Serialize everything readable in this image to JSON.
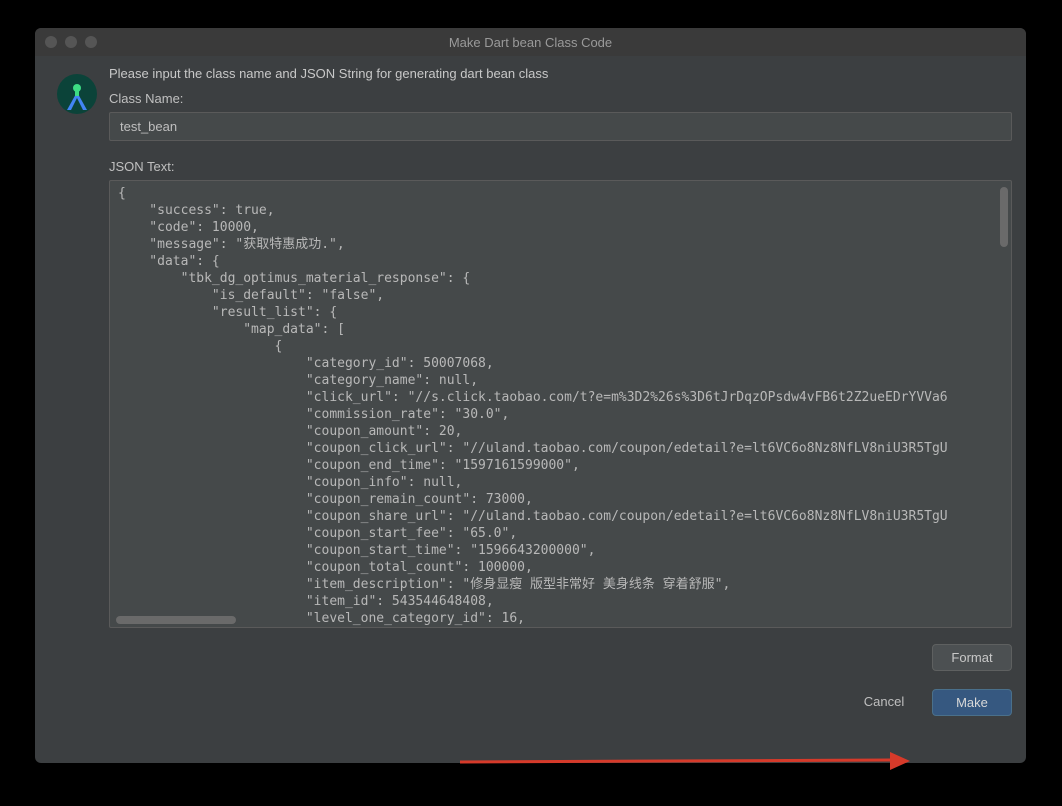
{
  "window": {
    "title": "Make Dart bean Class Code"
  },
  "instruction": "Please input the class name and JSON String for generating dart bean class",
  "classNameLabel": "Class Name:",
  "classNameValue": "test_bean",
  "jsonTextLabel": "JSON Text:",
  "jsonTextValue": "{\n    \"success\": true,\n    \"code\": 10000,\n    \"message\": \"获取特惠成功.\",\n    \"data\": {\n        \"tbk_dg_optimus_material_response\": {\n            \"is_default\": \"false\",\n            \"result_list\": {\n                \"map_data\": [\n                    {\n                        \"category_id\": 50007068,\n                        \"category_name\": null,\n                        \"click_url\": \"//s.click.taobao.com/t?e=m%3D2%26s%3D6tJrDqzOPsdw4vFB6t2Z2ueEDrYVVa6\n                        \"commission_rate\": \"30.0\",\n                        \"coupon_amount\": 20,\n                        \"coupon_click_url\": \"//uland.taobao.com/coupon/edetail?e=lt6VC6o8Nz8NfLV8niU3R5TgU\n                        \"coupon_end_time\": \"1597161599000\",\n                        \"coupon_info\": null,\n                        \"coupon_remain_count\": 73000,\n                        \"coupon_share_url\": \"//uland.taobao.com/coupon/edetail?e=lt6VC6o8Nz8NfLV8niU3R5TgU\n                        \"coupon_start_fee\": \"65.0\",\n                        \"coupon_start_time\": \"1596643200000\",\n                        \"coupon_total_count\": 100000,\n                        \"item_description\": \"修身显瘦 版型非常好 美身线条 穿着舒服\",\n                        \"item_id\": 543544648408,\n                        \"level_one_category_id\": 16,",
  "buttons": {
    "format": "Format",
    "cancel": "Cancel",
    "make": "Make"
  },
  "icons": {
    "androidStudio": "android-studio-icon"
  }
}
